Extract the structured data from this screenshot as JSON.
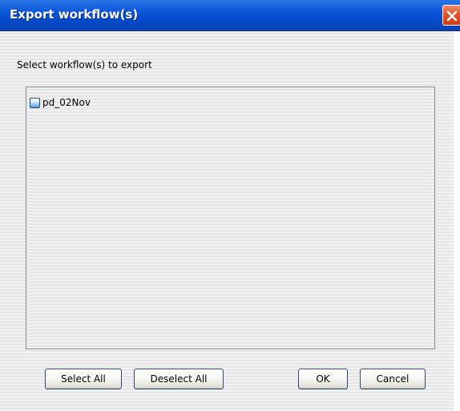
{
  "window": {
    "title": "Export workflow(s)"
  },
  "dialog": {
    "prompt_label": "Select workflow(s) to export",
    "workflows": [
      {
        "name": "pd_02Nov",
        "checked": false
      }
    ]
  },
  "buttons": {
    "select_all": "Select All",
    "deselect_all": "Deselect All",
    "ok": "OK",
    "cancel": "Cancel"
  },
  "icons": {
    "close": "close-icon"
  },
  "colors": {
    "titlebar": "#0a56d8",
    "close_button": "#e2532c"
  }
}
